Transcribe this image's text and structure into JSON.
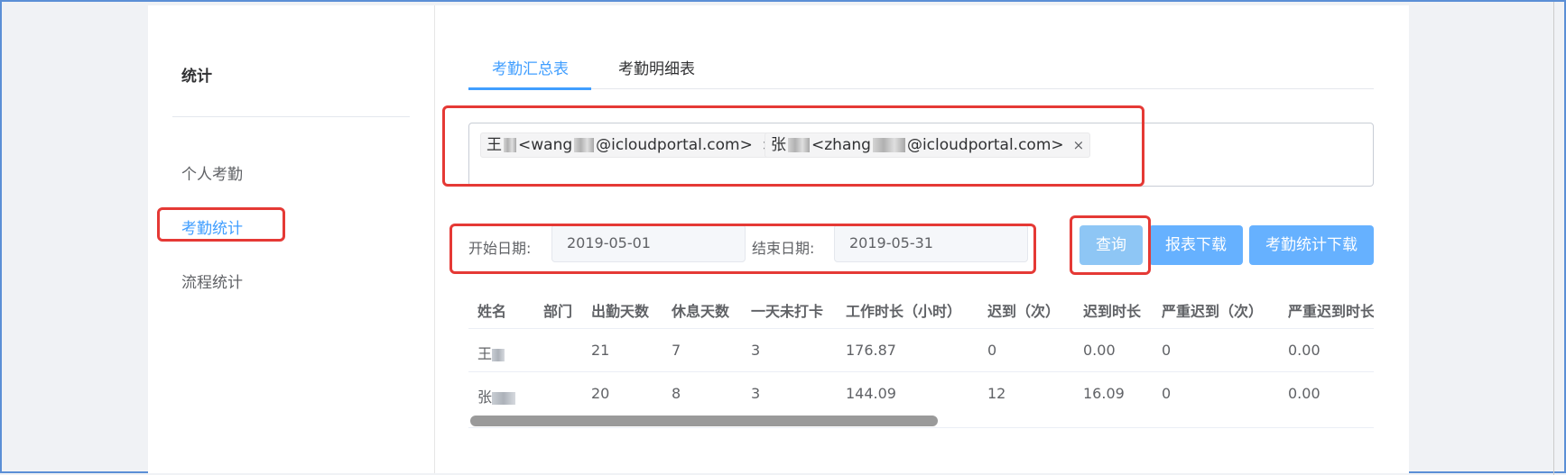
{
  "sidebar": {
    "title": "统计",
    "items": [
      {
        "label": "个人考勤"
      },
      {
        "label": "考勤统计"
      },
      {
        "label": "流程统计"
      }
    ]
  },
  "tabs": [
    {
      "label": "考勤汇总表",
      "active": true
    },
    {
      "label": "考勤明细表",
      "active": false
    }
  ],
  "recipients": [
    {
      "name": "王",
      "email_prefix": "<wang",
      "email_suffix": "@icloudportal.com>"
    },
    {
      "name": "张",
      "email_prefix": "<zhang",
      "email_suffix": "@icloudportal.com>"
    }
  ],
  "filters": {
    "start_label": "开始日期:",
    "start_value": "2019-05-01",
    "end_label": "结束日期:",
    "end_value": "2019-05-31"
  },
  "buttons": {
    "query": "查询",
    "report_download": "报表下载",
    "stats_download": "考勤统计下载"
  },
  "table": {
    "columns": [
      "姓名",
      "部门",
      "出勤天数",
      "休息天数",
      "一天未打卡",
      "工作时长（小时）",
      "迟到（次）",
      "迟到时长",
      "严重迟到（次）",
      "严重迟到时长"
    ],
    "rows": [
      {
        "name": "王",
        "dept": "",
        "attend": "21",
        "rest": "7",
        "missed": "3",
        "hours": "176.87",
        "late": "0",
        "late_dur": "0.00",
        "severe": "0",
        "severe_dur": "0.00"
      },
      {
        "name": "张",
        "dept": "",
        "attend": "20",
        "rest": "8",
        "missed": "3",
        "hours": "144.09",
        "late": "12",
        "late_dur": "16.09",
        "severe": "0",
        "severe_dur": "0.00"
      }
    ]
  },
  "close_glyph": "×",
  "colors": {
    "accent": "#409eff",
    "highlight_box": "#e53935",
    "button": "#66b1ff"
  }
}
